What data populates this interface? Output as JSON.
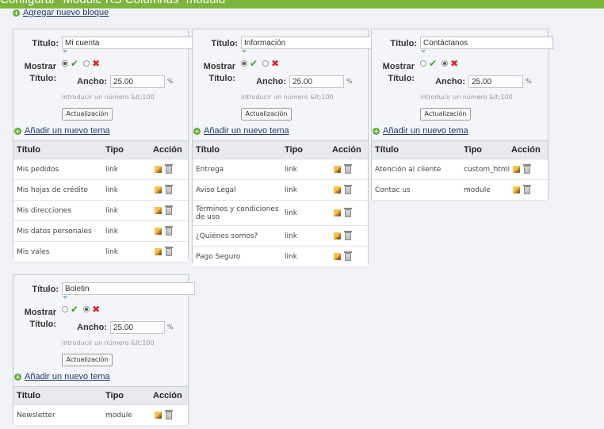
{
  "page": {
    "title": "Configurar \"Module RS Columnas\" módulo"
  },
  "add_block": "Agregar nuevo bloque",
  "labels": {
    "titulo": "Título:",
    "mostrar": "Mostrar",
    "titulo2": "Título:",
    "ancho": "Ancho:",
    "pct": "%",
    "hint": "introducir un número &lt;100",
    "update": "Actualización",
    "add_theme": "Añadir un nuevo tema",
    "col_title": "Título",
    "col_type": "Tipo",
    "col_action": "Acción"
  },
  "blocks": [
    {
      "title": "Mi cuenta",
      "width": "25.00",
      "show_title": true,
      "rows": [
        {
          "title": "Mis pedidos",
          "type": "link"
        },
        {
          "title": "Mis hojas de crédito",
          "type": "link"
        },
        {
          "title": "Mis direcciones",
          "type": "link"
        },
        {
          "title": "Mis datos personales",
          "type": "link"
        },
        {
          "title": "Mis vales",
          "type": "link"
        }
      ]
    },
    {
      "title": "Información",
      "width": "25.00",
      "show_title": true,
      "rows": [
        {
          "title": "Entrega",
          "type": "link"
        },
        {
          "title": "Aviso Legal",
          "type": "link"
        },
        {
          "title": "Términos y condiciones de uso",
          "type": "link"
        },
        {
          "title": "¿Quiénes somos?",
          "type": "link"
        },
        {
          "title": "Pago Seguro",
          "type": "link"
        }
      ]
    },
    {
      "title": "Contáctanos",
      "width": "25.00",
      "show_title": false,
      "rows": [
        {
          "title": "Atención al cliente",
          "type": "custom_html"
        },
        {
          "title": "Contac us",
          "type": "module"
        }
      ]
    },
    {
      "title": "Boletin",
      "width": "25.00",
      "show_title": false,
      "rows": [
        {
          "title": "Newsletter",
          "type": "module"
        }
      ]
    }
  ]
}
